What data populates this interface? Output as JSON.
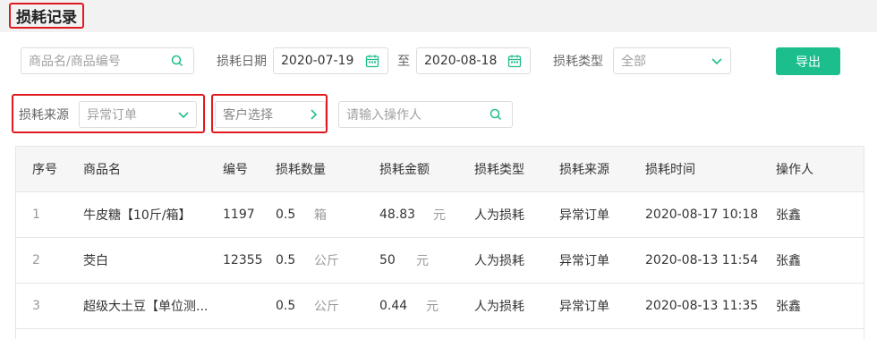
{
  "page_title": "损耗记录",
  "filters": {
    "product_placeholder": "商品名/商品编号",
    "date_label": "损耗日期",
    "date_from": "2020-07-19",
    "date_sep": "至",
    "date_to": "2020-08-18",
    "type_label": "损耗类型",
    "type_value": "全部",
    "export_label": "导出",
    "source_label": "损耗来源",
    "source_value": "异常订单",
    "customer_label": "客户选择",
    "operator_placeholder": "请输入操作人"
  },
  "table": {
    "headers": [
      "序号",
      "商品名",
      "编号",
      "损耗数量",
      "损耗金额",
      "损耗类型",
      "损耗来源",
      "损耗时间",
      "操作人"
    ],
    "rows": [
      {
        "no": "1",
        "name": "牛皮糖【10斤/箱】",
        "code": "1197",
        "qty": "0.5",
        "unit": "箱",
        "amount": "48.83",
        "currency": "元",
        "type": "人为损耗",
        "source": "异常订单",
        "time": "2020-08-17 10:18",
        "operator": "张鑫"
      },
      {
        "no": "2",
        "name": "茭白",
        "code": "12355",
        "qty": "0.5",
        "unit": "公斤",
        "amount": "50",
        "currency": "元",
        "type": "人为损耗",
        "source": "异常订单",
        "time": "2020-08-13 11:54",
        "operator": "张鑫"
      },
      {
        "no": "3",
        "name": "超级大土豆【单位测...",
        "code": "",
        "qty": "0.5",
        "unit": "公斤",
        "amount": "0.44",
        "currency": "元",
        "type": "人为损耗",
        "source": "异常订单",
        "time": "2020-08-13 11:35",
        "operator": "张鑫"
      }
    ]
  },
  "colors": {
    "accent": "#1dbe8e",
    "highlight": "#e0191e"
  },
  "icons": [
    "search-icon",
    "calendar-icon",
    "chevron-down-icon",
    "chevron-right-icon"
  ]
}
